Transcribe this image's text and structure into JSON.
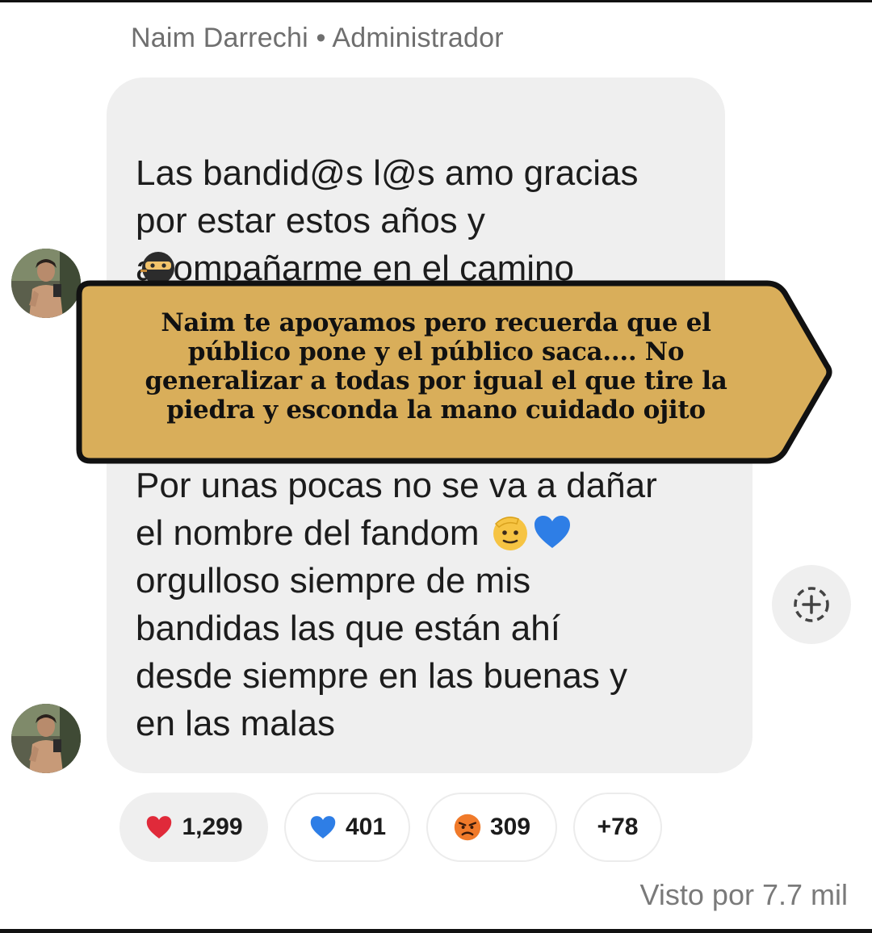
{
  "sender_line": "Naim Darrechi • Administrador",
  "message_1": "Las bandid@s l@s amo gracias\npor estar estos años y\nacompañarme en el camino",
  "message_2_lines": [
    "Por unas pocas no se va a dañar",
    "el nombre del fandom",
    "orgulloso siempre de mis",
    "bandidas las que están ahí",
    "desde siempre en las buenas y",
    "en las malas"
  ],
  "overlay_banner": "Naim te apoyamos pero recuerda que el público pone y el público saca.... No generalizar a todas por igual el que tire la piedra y esconda la mano cuidado ojito",
  "reactions": [
    {
      "icon": "red-heart-icon",
      "count": "1,299"
    },
    {
      "icon": "blue-heart-icon",
      "count": "401"
    },
    {
      "icon": "angry-face-icon",
      "count": "309"
    },
    {
      "icon": "",
      "count": "+78"
    }
  ],
  "seen_by": "Visto por 7.7 mil",
  "colors": {
    "bubble": "#efefef",
    "banner": "#d9ae5a",
    "heart_red": "#e02a3a",
    "heart_blue": "#2e7ee6"
  }
}
